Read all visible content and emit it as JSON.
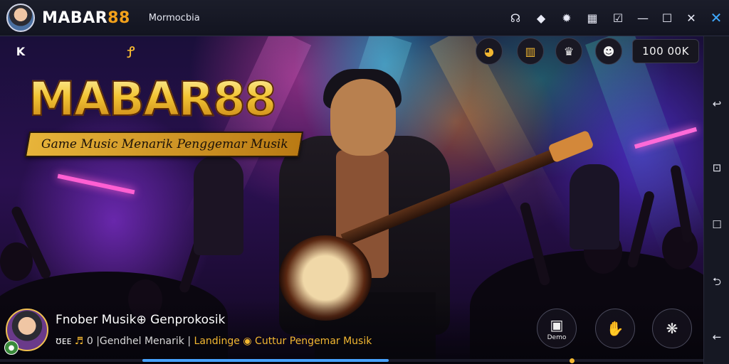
{
  "window": {
    "app_name_prefix": "MABAR",
    "app_name_number": "88",
    "subtitle": "Mormocbia"
  },
  "titlebar_icons": [
    {
      "name": "controller-icon",
      "glyph": "☊"
    },
    {
      "name": "puzzle-icon",
      "glyph": "◆"
    },
    {
      "name": "settings-icon",
      "glyph": "✹"
    },
    {
      "name": "keymap-icon",
      "glyph": "▦"
    },
    {
      "name": "checkbox-icon",
      "glyph": "☑"
    },
    {
      "name": "minimize-icon",
      "glyph": "—"
    },
    {
      "name": "maximize-icon",
      "glyph": "☐"
    },
    {
      "name": "close-icon",
      "glyph": "✕"
    },
    {
      "name": "collapse-icon",
      "glyph": "✕"
    }
  ],
  "scene": {
    "brand_prefix": "MABAR",
    "brand_number": "88",
    "tagline": "Game Music Menarik Penggemar Musik",
    "corner_icon": "K",
    "gold_icon": "Ꝭ"
  },
  "hud": {
    "buttons": [
      {
        "name": "hud-coin-icon",
        "glyph": "◕"
      },
      {
        "name": "hud-chest-icon",
        "glyph": "▥"
      },
      {
        "name": "hud-trophy-icon",
        "glyph": "♛"
      },
      {
        "name": "hud-mask-icon",
        "glyph": "☻"
      }
    ],
    "coins": "100 00K"
  },
  "stream": {
    "title": "Fnober Musik⊕ Genprokosik",
    "line_prefix": "ʊᴇᴇ",
    "line_part1": "0 |Gendhel Menarik",
    "line_part2": "Landinge",
    "line_part3": "Cuttur Pengemar Musik"
  },
  "right_buttons": [
    {
      "name": "demo-button",
      "glyph": "▣",
      "label": "Demo"
    },
    {
      "name": "hand-button",
      "glyph": "✋",
      "label": ""
    },
    {
      "name": "paw-button",
      "glyph": "❋",
      "label": ""
    }
  ],
  "progress": {
    "fill_fraction": 0.35
  },
  "sidebar": [
    {
      "name": "back-arrow-icon",
      "glyph": "↩"
    },
    {
      "name": "screenshot-icon",
      "glyph": "⊡"
    },
    {
      "name": "window-icon",
      "glyph": "☐"
    },
    {
      "name": "rotate-icon",
      "glyph": "⮌"
    },
    {
      "name": "back-icon",
      "glyph": "←"
    }
  ],
  "colors": {
    "accent": "#f2a11b",
    "progress": "#47a3ff",
    "gold": "#f2b731"
  }
}
